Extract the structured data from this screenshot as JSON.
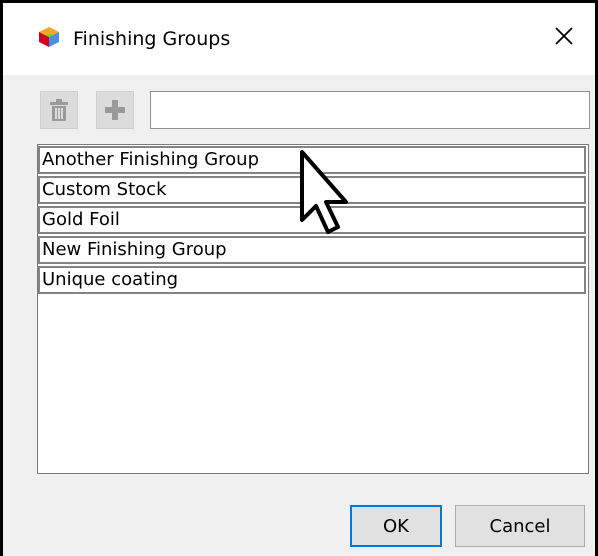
{
  "window": {
    "title": "Finishing Groups",
    "close_glyph": "✕"
  },
  "toolbar": {
    "delete_icon": "trash-icon",
    "add_icon": "plus-icon",
    "name_input_value": "",
    "name_input_placeholder": ""
  },
  "list": {
    "items": [
      "Another Finishing Group",
      "Custom Stock",
      "Gold Foil",
      "New Finishing Group",
      "Unique coating"
    ]
  },
  "buttons": {
    "ok_label": "OK",
    "cancel_label": "Cancel"
  },
  "colors": {
    "dialog_bg": "#f0f0f0",
    "accent": "#0078d7",
    "titlebar_bg": "#ffffff"
  }
}
